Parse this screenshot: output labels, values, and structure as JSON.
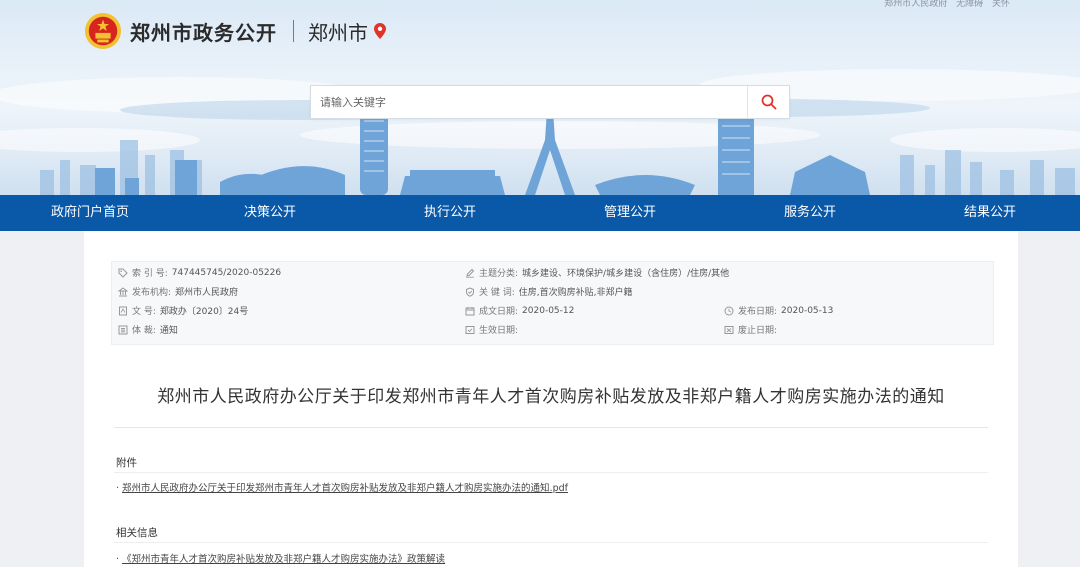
{
  "header": {
    "top_links": [
      "郑州市人民政府",
      "无障碍",
      "关怀"
    ],
    "site_title": "郑州市政务公开",
    "city": "郑州市",
    "colors": {
      "nav_bg": "#0a58a8",
      "emblem_red": "#d8241f",
      "emblem_gold": "#f2c230",
      "search_red": "#e0332a"
    }
  },
  "search": {
    "placeholder": "请输入关键字"
  },
  "nav": {
    "items": [
      {
        "label": "政府门户首页"
      },
      {
        "label": "决策公开"
      },
      {
        "label": "执行公开"
      },
      {
        "label": "管理公开"
      },
      {
        "label": "服务公开"
      },
      {
        "label": "结果公开"
      }
    ]
  },
  "meta": {
    "index_label": "索 引 号:",
    "index_value": "747445745/2020-05226",
    "publisher_label": "发布机构:",
    "publisher_value": "郑州市人民政府",
    "docno_label": "文        号:",
    "docno_value": "郑政办〔2020〕24号",
    "genre_label": "体        裁:",
    "genre_value": "通知",
    "topic_label": "主题分类:",
    "topic_value": "城乡建设、环境保护/城乡建设（含住房）/住房/其他",
    "keywords_label": "关 键 词:",
    "keywords_value": "住房,首次购房补贴,非郑户籍",
    "written_label": "成文日期:",
    "written_value": "2020-05-12",
    "effective_label": "生效日期:",
    "effective_value": "",
    "published_label": "发布日期:",
    "published_value": "2020-05-13",
    "expired_label": "废止日期:",
    "expired_value": ""
  },
  "document": {
    "title": "郑州市人民政府办公厅关于印发郑州市青年人才首次购房补贴发放及非郑户籍人才购房实施办法的通知"
  },
  "attachments": {
    "heading": "附件",
    "items": [
      "郑州市人民政府办公厅关于印发郑州市青年人才首次购房补贴发放及非郑户籍人才购房实施办法的通知.pdf"
    ]
  },
  "related": {
    "heading": "相关信息",
    "items": [
      "《郑州市青年人才首次购房补贴发放及非郑户籍人才购房实施办法》政策解读"
    ]
  }
}
